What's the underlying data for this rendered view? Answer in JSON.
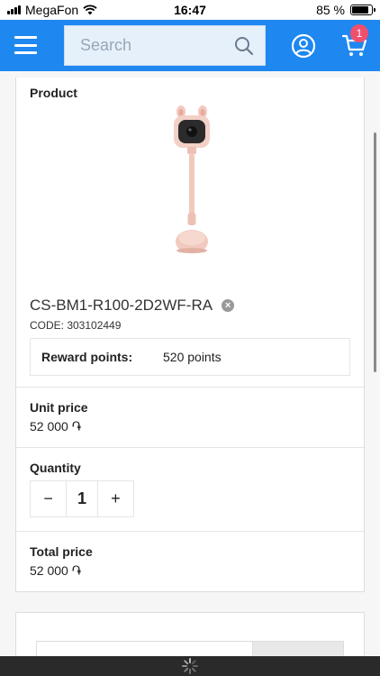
{
  "status_bar": {
    "carrier": "MegaFon",
    "time": "16:47",
    "battery": "85 %",
    "battery_level": 0.85
  },
  "header": {
    "search_placeholder": "Search",
    "cart_count": "1",
    "icons": [
      "menu-icon",
      "search-icon",
      "user-icon",
      "cart-icon"
    ],
    "accent_color": "#1e87f0",
    "badge_color": "#f0506e"
  },
  "product": {
    "section_label": "Product",
    "name": "CS-BM1-R100-2D2WF-RA",
    "code": "CODE: 303102449",
    "reward_label": "Reward points:",
    "reward_value": "520 points"
  },
  "unit_price": {
    "label": "Unit price",
    "value": "52 000 ֏"
  },
  "quantity": {
    "label": "Quantity",
    "value": "1",
    "minus": "−",
    "plus": "+"
  },
  "total_price": {
    "label": "Total price",
    "value": "52 000 ֏"
  }
}
